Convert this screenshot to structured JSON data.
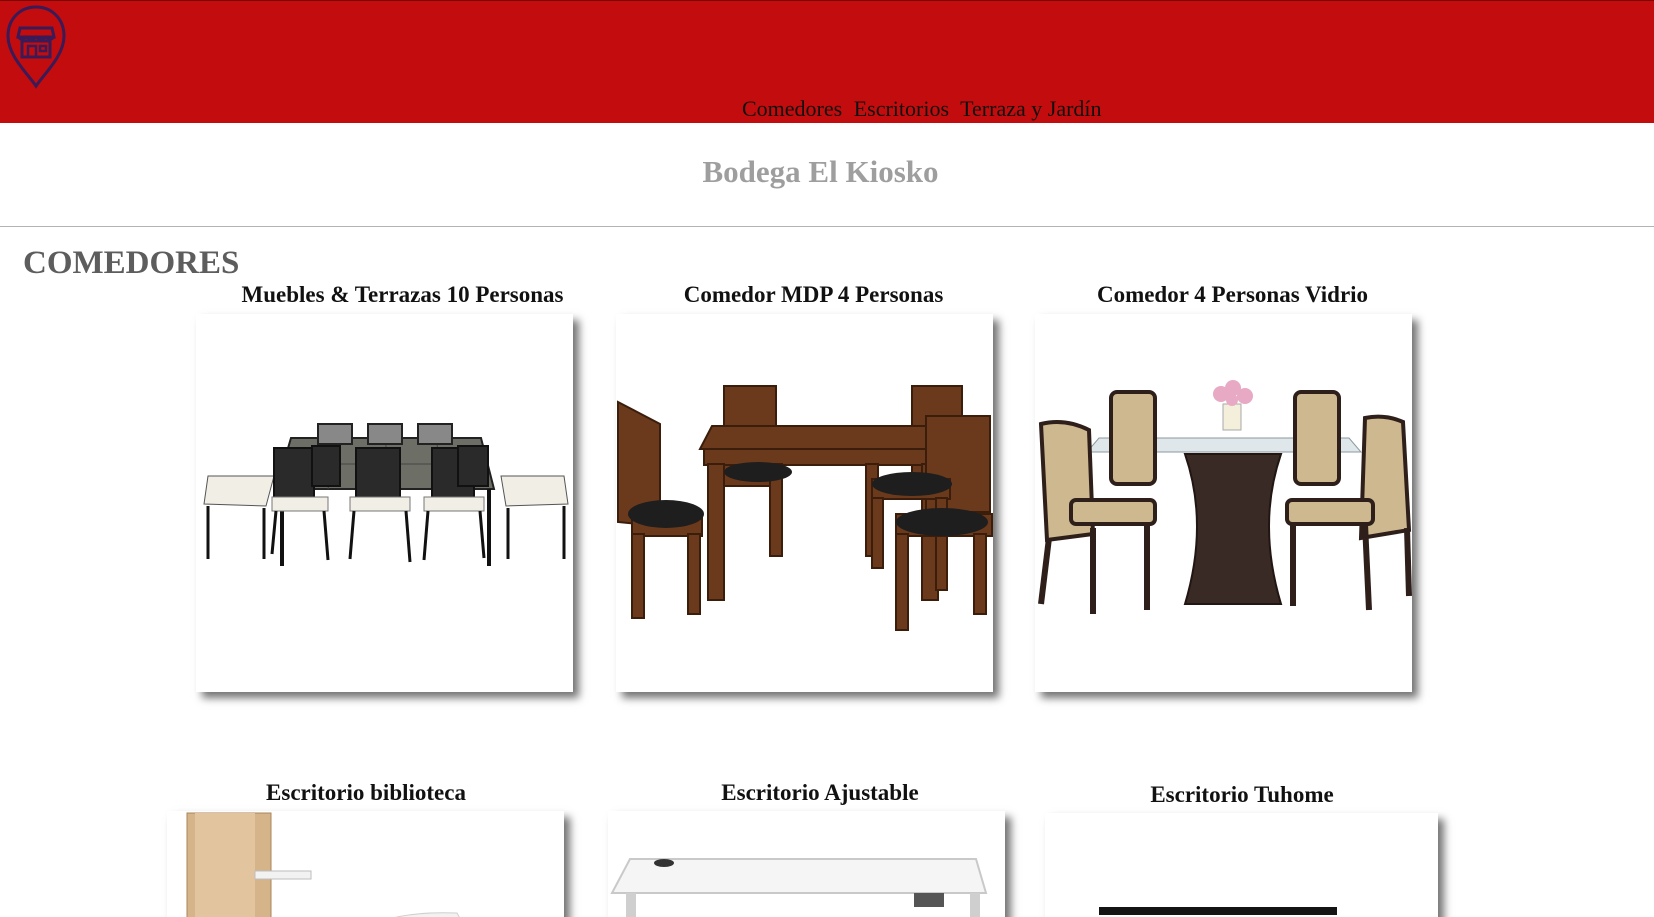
{
  "header": {
    "logo_icon": "store-location-pin-icon",
    "nav": [
      {
        "label": "Comedores"
      },
      {
        "label": "Escritorios"
      },
      {
        "label": "Terraza y Jardín"
      }
    ],
    "colors": {
      "bar": "#c30c0d",
      "logo": "#3a1a57"
    }
  },
  "brand": {
    "title": "Bodega El Kiosko"
  },
  "section": {
    "title": "COMEDORES"
  },
  "products": [
    {
      "title": "Muebles & Terrazas 10 Personas",
      "image_icon": "patio-dining-set-image"
    },
    {
      "title": "Comedor MDP 4 Personas",
      "image_icon": "wooden-dining-set-image"
    },
    {
      "title": "Comedor 4 Personas Vidrio",
      "image_icon": "glass-dining-set-image"
    },
    {
      "title": "Escritorio biblioteca",
      "image_icon": "bookshelf-desk-image"
    },
    {
      "title": "Escritorio Ajustable",
      "image_icon": "adjustable-desk-image"
    },
    {
      "title": "Escritorio Tuhome",
      "image_icon": "tuhome-desk-image"
    }
  ]
}
